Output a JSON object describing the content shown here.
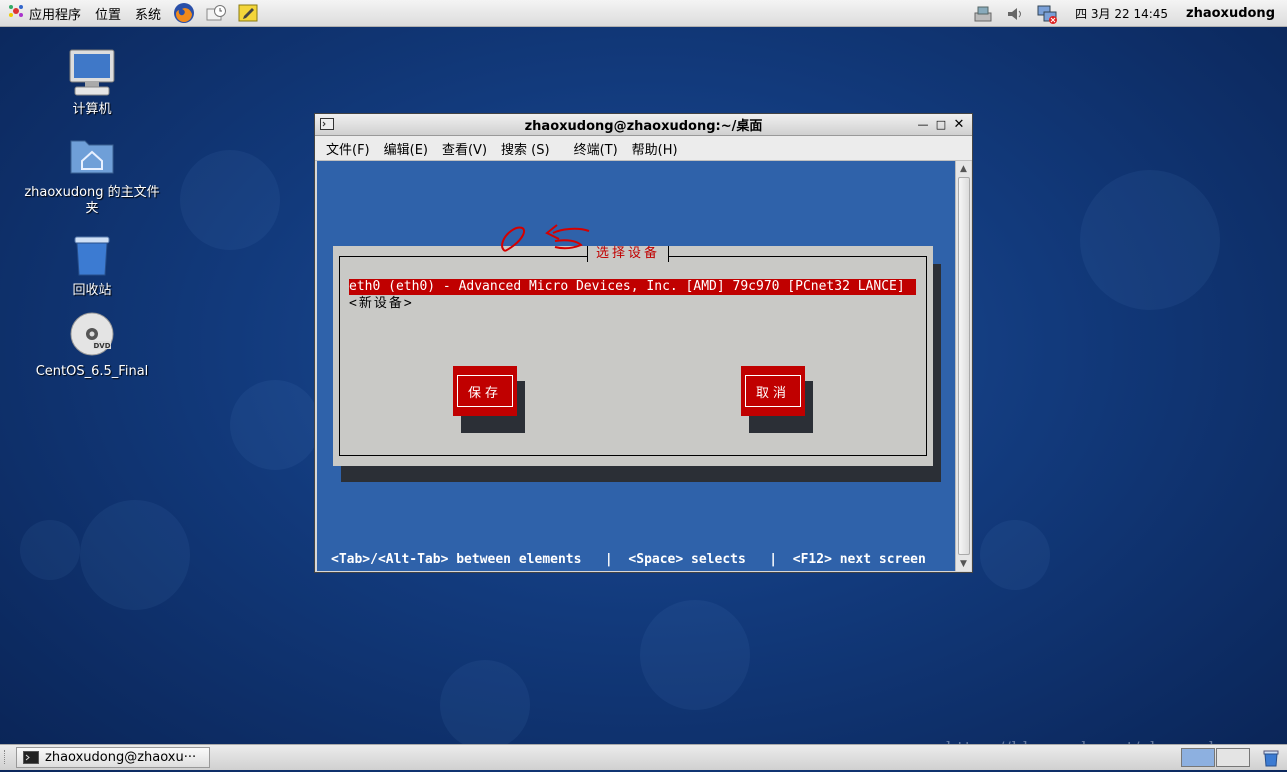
{
  "top_panel": {
    "menus": [
      "应用程序",
      "位置",
      "系统"
    ],
    "clock": "四 3月 22 14:45",
    "username": "zhaoxudong"
  },
  "desktop": {
    "icons": [
      {
        "label": "计算机",
        "icon": "computer-icon"
      },
      {
        "label": "zhaoxudong 的主文件夹",
        "icon": "home-folder-icon"
      },
      {
        "label": "回收站",
        "icon": "trash-icon"
      },
      {
        "label": "CentOS_6.5_Final",
        "icon": "dvd-icon"
      }
    ]
  },
  "terminal": {
    "title": "zhaoxudong@zhaoxudong:~/桌面",
    "menu": [
      "文件(F)",
      "编辑(E)",
      "查看(V)",
      "搜索 (S)",
      "终端(T)",
      "帮助(H)"
    ],
    "dialog": {
      "title": "选择设备",
      "device_item": "eth0 (eth0) - Advanced Micro Devices, Inc. [AMD] 79c970 [PCnet32 LANCE]",
      "new_device": "<新设备>",
      "save_label": "保存",
      "cancel_label": "取消"
    },
    "hint": "<Tab>/<Alt-Tab> between elements   |  <Space> selects   |  <F12> next screen"
  },
  "taskbar": {
    "item_label": "zhaoxudong@zhaoxu···"
  },
  "watermark": "https://blog.csdn.net/zhaoxudong",
  "colors": {
    "desktop": "#123a7c",
    "terminal_bg": "#2f62aa",
    "selection": "#c00000"
  }
}
